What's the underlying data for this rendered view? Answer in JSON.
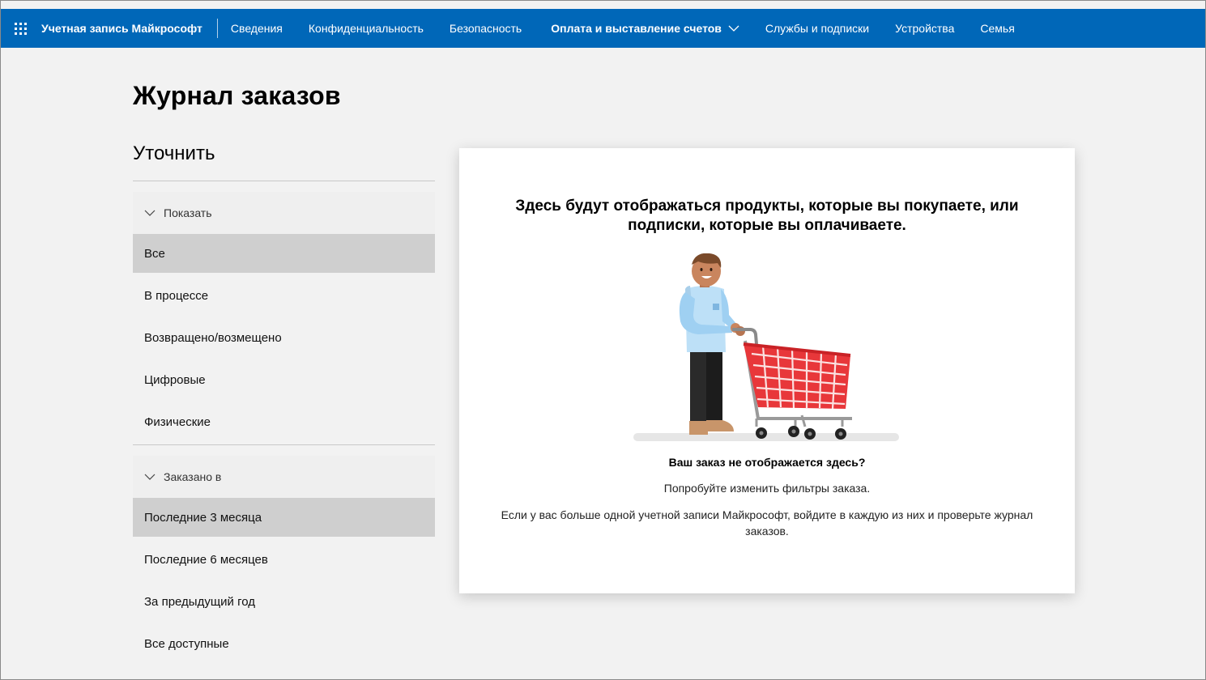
{
  "topbar": {
    "brand": "Учетная запись Майкрософт",
    "nav": [
      {
        "label": "Сведения"
      },
      {
        "label": "Конфиденциальность"
      },
      {
        "label": "Безопасность"
      },
      {
        "label": "Оплата и выставление счетов"
      },
      {
        "label": "Службы и подписки"
      },
      {
        "label": "Устройства"
      },
      {
        "label": "Семья"
      }
    ],
    "accent": "#0067b8"
  },
  "page": {
    "title": "Журнал заказов",
    "refine_title": "Уточнить"
  },
  "filters": {
    "show": {
      "label": "Показать",
      "options": [
        "Все",
        "В процессе",
        "Возвращено/возмещено",
        "Цифровые",
        "Физические"
      ],
      "selected": "Все"
    },
    "ordered": {
      "label": "Заказано в",
      "options": [
        "Последние 3 месяца",
        "Последние 6 месяцев",
        "За предыдущий год",
        "Все доступные"
      ],
      "selected": "Последние 3 месяца"
    }
  },
  "empty_state": {
    "headline": "Здесь будут отображаться продукты, которые вы покупаете, или подписки, которые вы оплачиваете.",
    "question": "Ваш заказ не отображается здесь?",
    "tip1": "Попробуйте изменить фильтры заказа.",
    "tip2": "Если у вас больше одной учетной записи Майкрософт, войдите в каждую из них и проверьте журнал заказов.",
    "illustration_icon": "person-with-shopping-cart-illustration"
  }
}
